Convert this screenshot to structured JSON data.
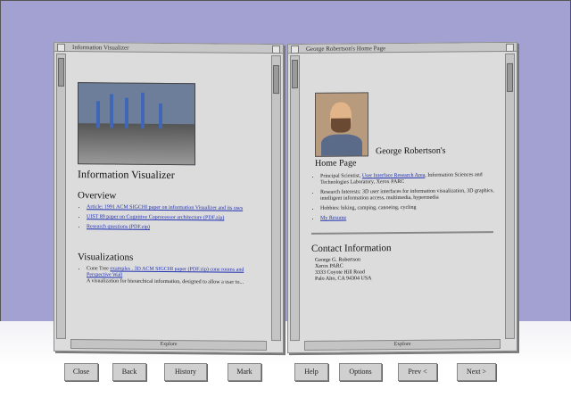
{
  "left_window": {
    "title": "Information Visualizer",
    "scroll_label": "Explore",
    "heading": "Information Visualizer",
    "overview_heading": "Overview",
    "overview_links": [
      "Article: 1991 ACM SIGCHI paper on information Visualizer and its uses",
      "UIST 89 paper on Cognitive Coprocessor architecture (PDF.zip)",
      "Research questions (PDF.zip)"
    ],
    "visualizations_heading": "Visualizations",
    "viz_item_label": "Cone Tree",
    "viz_item_link": "examples . 3D ACM SIGCHI paper (PDF.zip) cone rooms and Perspective Wall",
    "viz_item_text": "A visualization for hierarchical information, designed to allow a user to..."
  },
  "right_window": {
    "title": "George Robertson's Home Page",
    "scroll_label": "Explore",
    "name": "George Robertson's",
    "subtitle": "Home Page",
    "bullets": [
      {
        "pre": "Principal Scientist, ",
        "link": "User Interface Research Area",
        "post": ", Information Sciences and Technologies Laboratory, Xerox PARC"
      },
      {
        "pre": "Research Interests: 3D user interfaces for information visualization, 3D graphics, intelligent information access, multimedia, hypermedia",
        "link": "",
        "post": ""
      },
      {
        "pre": "Hobbies: hiking, camping, canoeing, cycling",
        "link": "",
        "post": ""
      },
      {
        "pre": "",
        "link": "My Resume",
        "post": ""
      }
    ],
    "contact_heading": "Contact Information",
    "contact_lines": [
      "George G. Robertson",
      "Xerox PARC",
      "3333 Coyote Hill Road",
      "Palo Alto, CA 94304 USA"
    ]
  },
  "buttons": [
    "Close",
    "Back",
    "History",
    "Mark",
    "Help",
    "Options",
    "Prev <",
    "Next >"
  ]
}
